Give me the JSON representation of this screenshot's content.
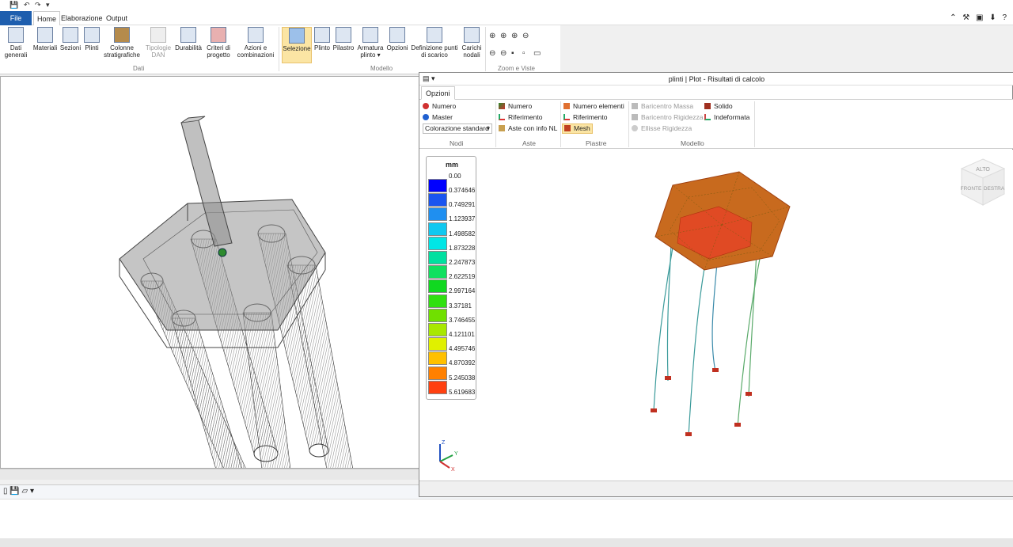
{
  "menu": {
    "file": "File",
    "tabs": [
      "Home",
      "Elaborazione",
      "Output"
    ]
  },
  "ribbon": {
    "buttons": [
      {
        "label": "Dati\ngenerali"
      },
      {
        "label": "Materiali"
      },
      {
        "label": "Sezioni"
      },
      {
        "label": "Plinti"
      },
      {
        "label": "Colonne\nstratigrafiche"
      },
      {
        "label": "Tipologie\nDAN",
        "disabled": true
      },
      {
        "label": "Durabilità"
      },
      {
        "label": "Criteri di\nprogetto"
      },
      {
        "label": "Azioni e\ncombinazioni"
      },
      {
        "label": "Selezione",
        "selected": true
      },
      {
        "label": "Plinto"
      },
      {
        "label": "Pilastro"
      },
      {
        "label": "Armatura\nplinto ▾"
      },
      {
        "label": "Opzioni"
      },
      {
        "label": "Definizione punti\ndi scarico"
      },
      {
        "label": "Carichi\nnodali"
      }
    ],
    "groups": {
      "dati": "Dati",
      "modello": "Modello",
      "zoom": "Zoom e Viste"
    }
  },
  "plot_window": {
    "title": "plinti | Plot - Risultati di calcolo",
    "tab": "Opzioni",
    "nodi": {
      "numero": "Numero",
      "master": "Master",
      "colorazione": "Colorazione standard",
      "group": "Nodi"
    },
    "aste": {
      "numero": "Numero",
      "riferimento": "Riferimento",
      "info_nl": "Aste con info NL",
      "group": "Aste"
    },
    "piastre": {
      "numero_elementi": "Numero elementi",
      "riferimento": "Riferimento",
      "mesh": "Mesh",
      "group": "Piastre"
    },
    "modello": {
      "baricentro_massa": "Baricentro Massa",
      "baricentro_rigidezza": "Baricentro Rigidezza",
      "ellisse_rigidezza": "Ellisse Rigidezza",
      "solido": "Solido",
      "indeformata": "Indeformata",
      "group": "Modello"
    },
    "nav_cube": {
      "top": "ALTO",
      "front": "FRONTE",
      "right": "DESTRA"
    }
  },
  "legend": {
    "unit": "mm",
    "zero": "0.00",
    "values": [
      "0.374646",
      "0.749291",
      "1.123937",
      "1.498582",
      "1.873228",
      "2.247873",
      "2.622519",
      "2.997164",
      "3.37181",
      "3.746455",
      "4.121101",
      "4.495746",
      "4.870392",
      "5.245038",
      "5.619683"
    ],
    "colors": [
      "#0000ff",
      "#1a55f0",
      "#1f8ff0",
      "#10c8f0",
      "#00e6e6",
      "#00e0a0",
      "#10e060",
      "#10d820",
      "#30e010",
      "#70e000",
      "#a8e800",
      "#e0f000",
      "#ffc000",
      "#ff8000",
      "#ff4010"
    ]
  },
  "axes": {
    "z": "Z",
    "y": "Y",
    "x": "X"
  }
}
